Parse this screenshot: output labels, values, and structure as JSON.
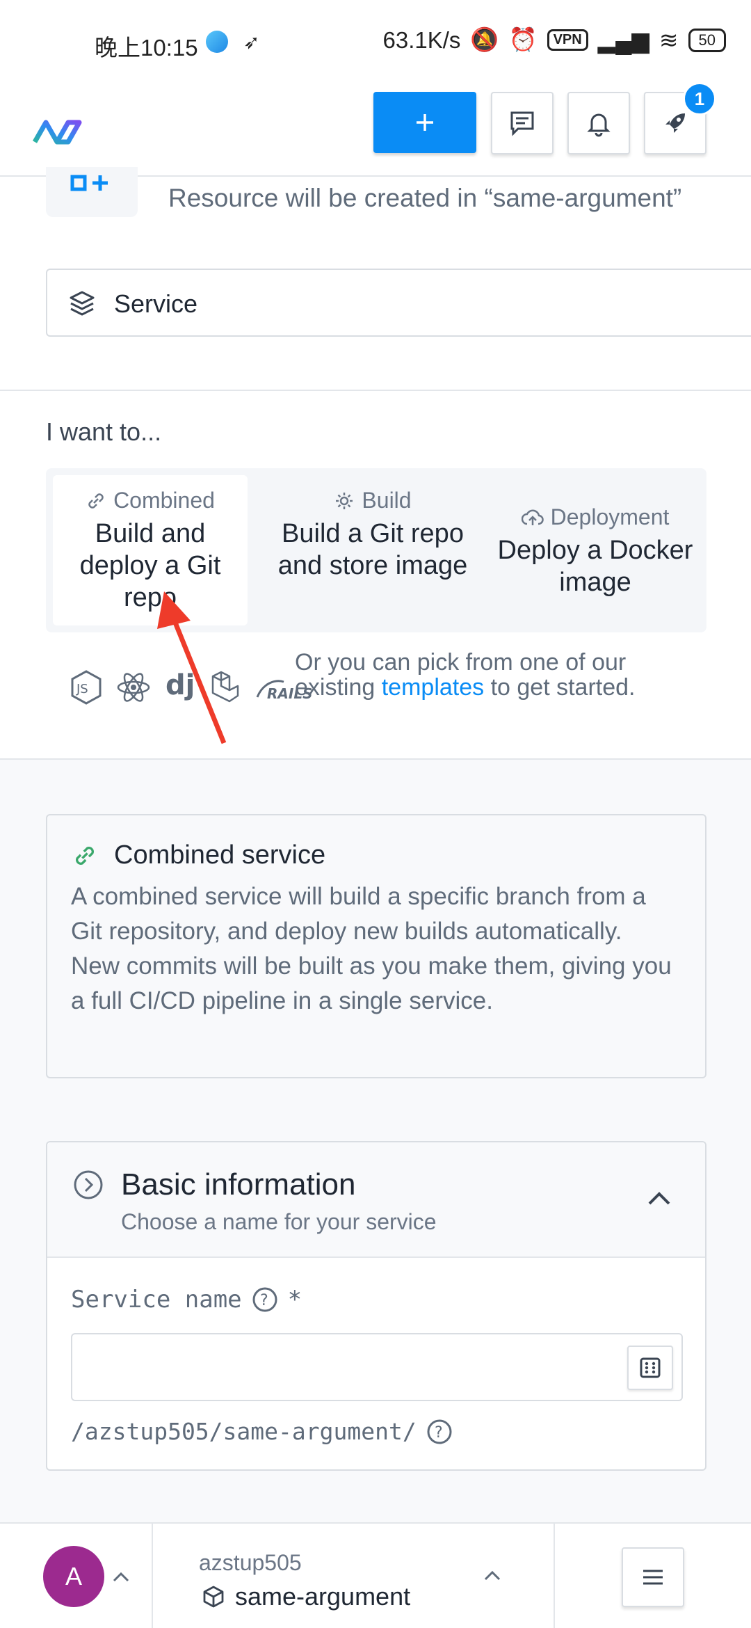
{
  "status_bar": {
    "time": "晚上10:15",
    "speed": "63.1K/s",
    "vpn": "VPN",
    "battery": "50"
  },
  "topnav": {
    "notifications_count": "1"
  },
  "resource": {
    "text": "Resource will be created in “same-argument”"
  },
  "service_type": {
    "label": "Service"
  },
  "want": {
    "heading": "I want to...",
    "options": [
      {
        "tag": "Combined",
        "title": "Build and deploy a Git repo"
      },
      {
        "tag": "Build",
        "title": "Build a Git repo and store image"
      },
      {
        "tag": "Deployment",
        "title": "Deploy a Docker image"
      }
    ]
  },
  "templates": {
    "text_before": "Or you can pick from one of our existing ",
    "link": "templates",
    "text_after": " to get started.",
    "icons": [
      "nodejs-icon",
      "react-icon",
      "django-icon",
      "laravel-icon",
      "rails-icon"
    ]
  },
  "info_card": {
    "title": "Combined service",
    "description": "A combined service will build a specific branch from a Git repository, and deploy new builds automatically. New commits will be built as you make them, giving you a full CI/CD pipeline in a single service."
  },
  "basic": {
    "title": "Basic information",
    "subtitle": "Choose a name for your service",
    "service_name_label": "Service name",
    "required_mark": "*",
    "service_name_value": "",
    "path": "/azstup505/same-argument/"
  },
  "bottom": {
    "avatar_letter": "A",
    "org": "azstup505",
    "project": "same-argument"
  },
  "colors": {
    "accent": "#0a8cf5",
    "avatar": "#9c2a8f",
    "link_icon_green": "#3aa86b",
    "annotation_arrow": "#ee3b2a"
  }
}
